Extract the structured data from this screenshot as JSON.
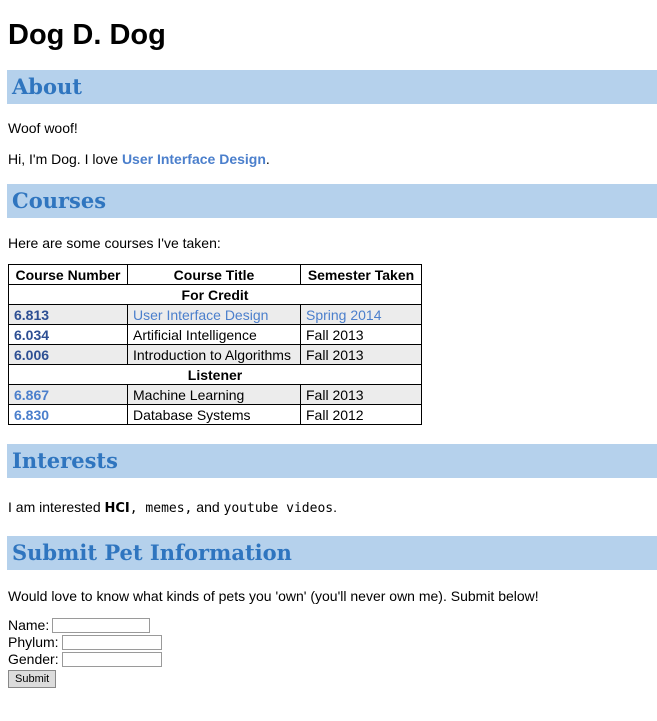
{
  "page_title": "Dog D. Dog",
  "about": {
    "heading": "About",
    "line1": "Woof woof!",
    "line2_prefix": "Hi, I'm Dog. I love ",
    "line2_link": "User Interface Design",
    "line2_suffix": "."
  },
  "courses": {
    "heading": "Courses",
    "intro": "Here are some courses I've taken:",
    "columns": [
      "Course Number",
      "Course Title",
      "Semester Taken"
    ],
    "groups": [
      {
        "label": "For Credit",
        "rows": [
          {
            "number": "6.813",
            "title": "User Interface Design",
            "semester": "Spring 2014"
          },
          {
            "number": "6.034",
            "title": "Artificial Intelligence",
            "semester": "Fall 2013"
          },
          {
            "number": "6.006",
            "title": "Introduction to Algorithms",
            "semester": "Fall 2013"
          }
        ]
      },
      {
        "label": "Listener",
        "rows": [
          {
            "number": "6.867",
            "title": "Machine Learning",
            "semester": "Fall 2013"
          },
          {
            "number": "6.830",
            "title": "Database Systems",
            "semester": "Fall 2012"
          }
        ]
      }
    ]
  },
  "interests": {
    "heading": "Interests",
    "prefix": "I am interested ",
    "hci": "HCI",
    "memes": ", memes,",
    "and": " and ",
    "youtube": "youtube videos",
    "suffix": "."
  },
  "submit": {
    "heading": "Submit Pet Information",
    "intro": "Would love to know what kinds of pets you 'own' (you'll never own me). Submit below!",
    "name_label": "Name:",
    "phylum_label": "Phylum:",
    "gender_label": "Gender:",
    "name_value": "",
    "phylum_value": "",
    "gender_value": "",
    "button_label": "Submit"
  },
  "colors": {
    "section_bar": "#b5d1ec",
    "section_text": "#2f75bf",
    "link": "#4b7fcc",
    "row_shade": "#ececec"
  }
}
